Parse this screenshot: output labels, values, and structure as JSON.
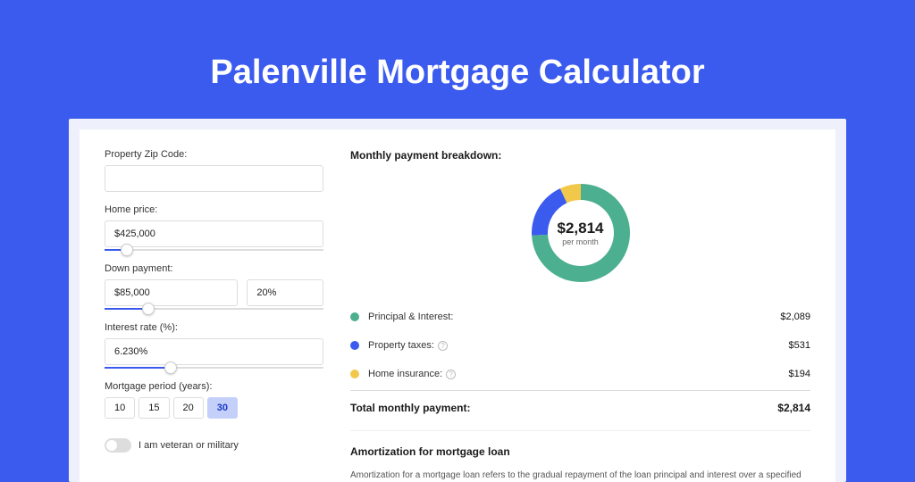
{
  "hero": {
    "title": "Palenville Mortgage Calculator"
  },
  "form": {
    "zip_label": "Property Zip Code:",
    "zip_value": "",
    "home_price_label": "Home price:",
    "home_price_value": "$425,000",
    "home_price_slider_pct": 10,
    "down_label": "Down payment:",
    "down_amount": "$85,000",
    "down_pct": "20%",
    "down_slider_pct": 20,
    "rate_label": "Interest rate (%):",
    "rate_value": "6.230%",
    "rate_slider_pct": 30,
    "period_label": "Mortgage period (years):",
    "period_options": [
      "10",
      "15",
      "20",
      "30"
    ],
    "period_selected": "30",
    "veteran_label": "I am veteran or military"
  },
  "breakdown": {
    "title": "Monthly payment breakdown:",
    "donut": {
      "amount": "$2,814",
      "subtitle": "per month",
      "segments": [
        {
          "color": "#4CAF8F",
          "frac": 0.742
        },
        {
          "color": "#3B5BEF",
          "frac": 0.189
        },
        {
          "color": "#F2C84B",
          "frac": 0.069
        }
      ]
    },
    "items": [
      {
        "color": "#4CAF8F",
        "label": "Principal & Interest:",
        "help": false,
        "value": "$2,089"
      },
      {
        "color": "#3B5BEF",
        "label": "Property taxes:",
        "help": true,
        "value": "$531"
      },
      {
        "color": "#F2C84B",
        "label": "Home insurance:",
        "help": true,
        "value": "$194"
      }
    ],
    "total_label": "Total monthly payment:",
    "total_value": "$2,814"
  },
  "amortization": {
    "title": "Amortization for mortgage loan",
    "body": "Amortization for a mortgage loan refers to the gradual repayment of the loan principal and interest over a specified"
  },
  "chart_data": {
    "type": "pie",
    "title": "Monthly payment breakdown",
    "categories": [
      "Principal & Interest",
      "Property taxes",
      "Home insurance"
    ],
    "values": [
      2089,
      531,
      194
    ],
    "colors": [
      "#4CAF8F",
      "#3B5BEF",
      "#F2C84B"
    ],
    "total": 2814,
    "unit": "USD/month"
  }
}
